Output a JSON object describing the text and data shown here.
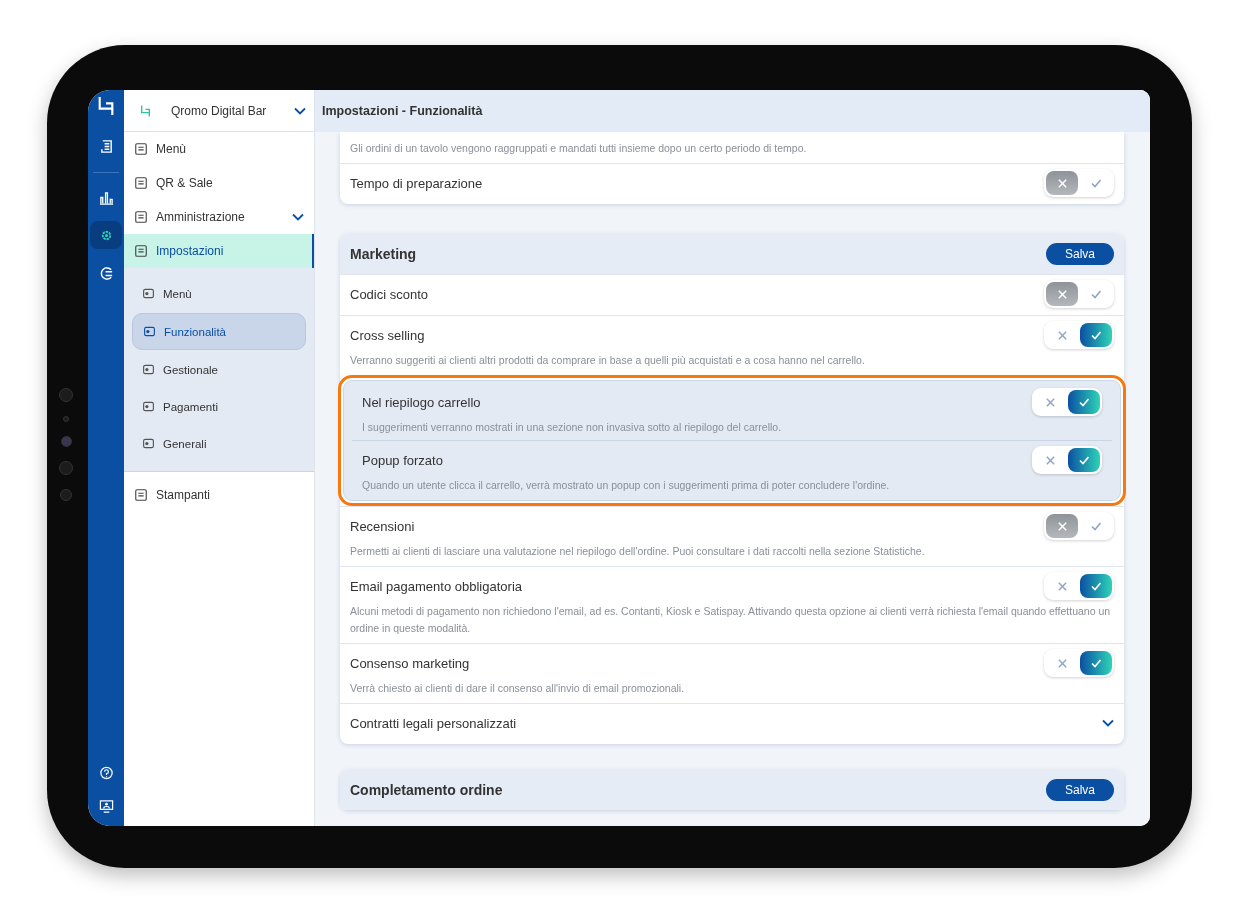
{
  "header": {
    "title": "Impostazioni - Funzionalità"
  },
  "rail": [
    {
      "selected": false
    },
    {
      "selected": false
    },
    {
      "selected": true
    },
    {
      "selected": false
    }
  ],
  "brand": {
    "name": "Qromo Digital Bar"
  },
  "nav": [
    {
      "label": "Menù",
      "selected": false
    },
    {
      "label": "QR & Sale",
      "selected": false
    },
    {
      "label": "Amministrazione",
      "selected": false,
      "expanded": false
    },
    {
      "label": "Impostazioni",
      "selected": true,
      "expanded": true,
      "children": [
        {
          "label": "Menù",
          "selected": false
        },
        {
          "label": "Funzionalità",
          "selected": true
        },
        {
          "label": "Gestionale",
          "selected": false
        },
        {
          "label": "Pagamenti",
          "selected": false
        },
        {
          "label": "Generali",
          "selected": false
        }
      ]
    },
    {
      "label": "Stampanti",
      "selected": false
    }
  ],
  "cards": [
    {
      "rows": [
        {
          "kind": "note",
          "description": "Gli ordini di un tavolo vengono raggruppati e mandati tutti insieme dopo un certo periodo di tempo."
        },
        {
          "kind": "toggle",
          "label": "Tempo di preparazione",
          "on": false
        }
      ]
    },
    {
      "title": "Marketing",
      "save": "Salva",
      "rows": [
        {
          "kind": "toggle",
          "label": "Codici sconto",
          "on": false
        },
        {
          "kind": "toggle",
          "label": "Cross selling",
          "on": true,
          "description": "Verranno suggeriti ai clienti altri prodotti da comprare in base a quelli più acquistati e a cosa hanno nel carrello."
        },
        {
          "kind": "group",
          "highlighted": true,
          "children": [
            {
              "kind": "toggle",
              "label": "Nel riepilogo carrello",
              "on": true,
              "description": "I suggerimenti verranno mostrati in una sezione non invasiva sotto al riepilogo del carrello."
            },
            {
              "kind": "toggle",
              "label": "Popup forzato",
              "on": true,
              "description": "Quando un utente clicca il carrello, verrà mostrato un popup con i suggerimenti prima di poter concludere l'ordine."
            }
          ]
        },
        {
          "kind": "toggle",
          "label": "Recensioni",
          "on": false,
          "description": "Permetti ai clienti di lasciare una valutazione nel riepilogo dell'ordine. Puoi consultare i dati raccolti nella sezione Statistiche."
        },
        {
          "kind": "toggle",
          "label": "Email pagamento obbligatoria",
          "on": true,
          "description": "Alcuni metodi di pagamento non richiedono l'email, ad es. Contanti, Kiosk e Satispay. Attivando questa opzione ai clienti verrà richiesta l'email quando effettuano un ordine in queste modalità."
        },
        {
          "kind": "toggle",
          "label": "Consenso marketing",
          "on": true,
          "description": "Verrà chiesto ai clienti di dare il consenso all'invio di email promozionali."
        },
        {
          "kind": "expand",
          "label": "Contratti legali personalizzati",
          "expanded": false
        }
      ]
    },
    {
      "title": "Completamento ordine",
      "save": "Salva"
    }
  ]
}
